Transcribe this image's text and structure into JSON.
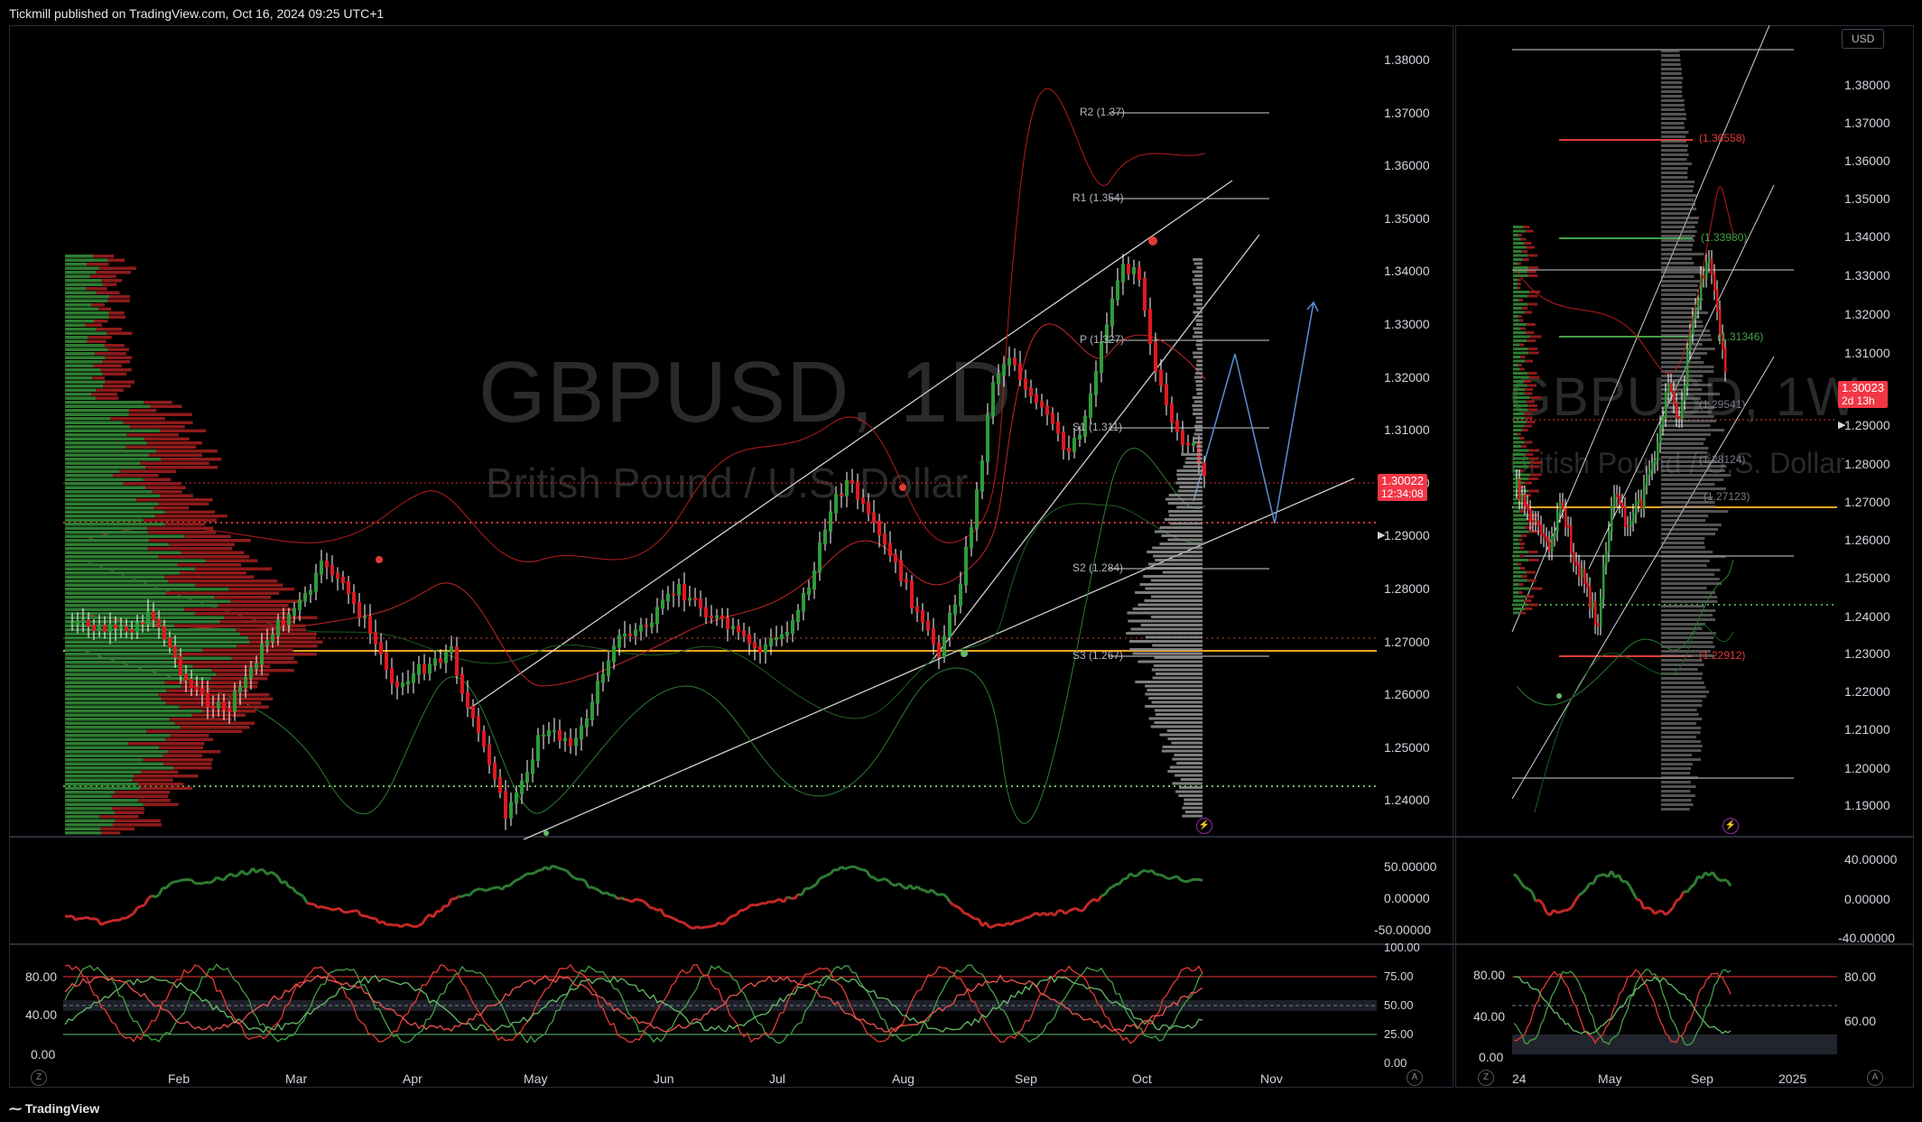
{
  "header": {
    "published_by": "Tickmill published on TradingView.com, Oct 16, 2024 09:25 UTC+1"
  },
  "footer": {
    "brand": "TradingView"
  },
  "left_chart": {
    "symbol_watermark": "GBPUSD, 1D",
    "description_watermark": "British Pound / U.S. Dollar",
    "price_axis": [
      "1.38000",
      "1.37000",
      "1.36000",
      "1.35000",
      "1.34000",
      "1.33000",
      "1.32000",
      "1.31000",
      "1.30000",
      "1.29000",
      "1.28000",
      "1.27000",
      "1.26000",
      "1.25000",
      "1.24000"
    ],
    "current_price": "1.30022",
    "countdown": "12:34:08",
    "pivots": {
      "r2": "R2 (1.37)",
      "r1": "R1 (1.354)",
      "p": "P (1.327)",
      "s1": "S1 (1.311)",
      "s2": "S2 (1.284)",
      "s3": "S3 (1.267)"
    },
    "time_axis": [
      "Feb",
      "Mar",
      "Apr",
      "May",
      "Jun",
      "Jul",
      "Aug",
      "Sep",
      "Oct",
      "Nov"
    ],
    "osc1_axis": [
      "50.00000",
      "0.00000",
      "-50.00000"
    ],
    "osc2_left_axis": [
      "80.00",
      "40.00",
      "0.00"
    ],
    "osc2_right_axis": [
      "100.00",
      "75.00",
      "50.00",
      "25.00",
      "0.00"
    ],
    "z_button": "Z",
    "a_button": "A"
  },
  "right_chart": {
    "currency_button": "USD",
    "symbol_watermark": "GBPUSD, 1W",
    "description_watermark": "British Pound / U.S. Dollar",
    "price_axis": [
      "1.38000",
      "1.37000",
      "1.36000",
      "1.35000",
      "1.34000",
      "1.33000",
      "1.32000",
      "1.31000",
      "1.29000",
      "1.28000",
      "1.27000",
      "1.26000",
      "1.25000",
      "1.24000",
      "1.23000",
      "1.22000",
      "1.21000",
      "1.20000",
      "1.19000"
    ],
    "current_price": "1.30023",
    "countdown": "2d 13h",
    "levels": [
      "(1.36558)",
      "(1.33980)",
      "(1.31346)",
      "(1.29541)",
      "(1.28124)",
      "(1.27123)",
      "(1.22912)"
    ],
    "time_axis": [
      "24",
      "May",
      "Sep",
      "2025"
    ],
    "osc1_axis": [
      "40.00000",
      "0.00000",
      "-40.00000"
    ],
    "osc2_left_axis": [
      "80.00",
      "40.00",
      "0.00"
    ],
    "osc2_right_axis": [
      "80.00",
      "60.00"
    ],
    "z_button": "Z",
    "a_button": "A"
  },
  "colors": {
    "bull": "#2e9b3a",
    "bear": "#e0191f",
    "orange": "#f5a623",
    "pivot_line": "#cfcfcf",
    "red_dotted": "#d32f2f",
    "green_dotted": "#4caf50",
    "blue_proj": "#5b8fd6"
  }
}
